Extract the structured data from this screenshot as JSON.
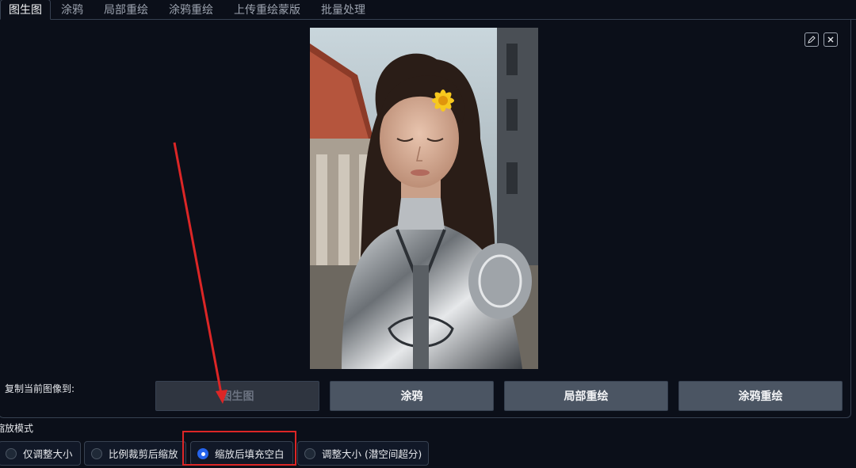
{
  "tabs": [
    {
      "label": "图生图",
      "active": true
    },
    {
      "label": "涂鸦",
      "active": false
    },
    {
      "label": "局部重绘",
      "active": false
    },
    {
      "label": "涂鸦重绘",
      "active": false
    },
    {
      "label": "上传重绘蒙版",
      "active": false
    },
    {
      "label": "批量处理",
      "active": false
    }
  ],
  "image_tools": {
    "edit_icon": "pencil-icon",
    "close_icon": "close-icon"
  },
  "copy_to": {
    "label": "复制当前图像到:",
    "buttons": [
      "图生图",
      "涂鸦",
      "局部重绘",
      "涂鸦重绘"
    ]
  },
  "resize_mode": {
    "label": "缩放模式",
    "options": [
      "仅调整大小",
      "比例裁剪后缩放",
      "缩放后填充空白",
      "调整大小 (潜空间超分)"
    ],
    "selected": "缩放后填充空白"
  },
  "colors": {
    "background": "#0b0f19",
    "button": "#4b5563",
    "accent": "#2563eb",
    "annotation": "#dc2626"
  }
}
